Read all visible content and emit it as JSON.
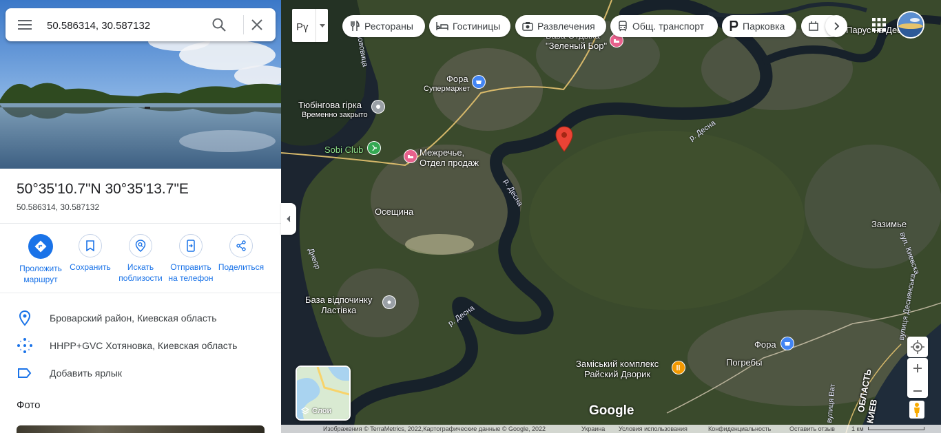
{
  "search": {
    "value": "50.586314, 30.587132"
  },
  "place": {
    "title": "50°35'10.7\"N 30°35'13.7\"E",
    "subtitle": "50.586314, 30.587132"
  },
  "actions": [
    {
      "label": "Проложить маршрут",
      "line1": "Проложить",
      "line2": "маршрут"
    },
    {
      "label": "Сохранить",
      "line1": "Сохранить",
      "line2": ""
    },
    {
      "label": "Искать поблизости",
      "line1": "Искать",
      "line2": "поблизости"
    },
    {
      "label": "Отправить на телефон",
      "line1": "Отправить",
      "line2": "на телефон"
    },
    {
      "label": "Поделиться",
      "line1": "Поделиться",
      "line2": ""
    }
  ],
  "info": {
    "address": "Броварский район, Киевская область",
    "pluscode": "HHPP+GVC Хотяновка, Киевская область",
    "label": "Добавить ярлык"
  },
  "photos_heading": "Фото",
  "map": {
    "language_button": "Рү",
    "chips": [
      "Рестораны",
      "Гостиницы",
      "Развлечения",
      "Общ. транспорт",
      "Парковка"
    ],
    "layers_label": "Слои",
    "google_logo": "Google",
    "labels": {
      "base_zeleny_bor_1": "База Отдыха",
      "base_zeleny_bor_2": "\"Зеленый Бор\"",
      "fora1": "Фора",
      "fora1_sub": "Супермаркет",
      "tubing": "Тюбінгова гірка",
      "tubing_sub": "Временно закрыто",
      "sobi": "Sobi Club",
      "mezhreche1": "Межречье,",
      "mezhreche2": "Отдел продаж",
      "osesсhina": "Осещина",
      "lastivka1": "База відпочинку",
      "lastivka2": "Ластівка",
      "zazimye": "Зазимье",
      "fora2": "Фора",
      "raysky1": "Заміський комплекс",
      "raysky2": "Райский Дворик",
      "pogreby": "Погребы",
      "parus": "Парус на Десне",
      "river_desna1": "р. Десна",
      "river_desna2": "р. Десна",
      "river_desna3": "р. Десна",
      "dnepr": "Днепр",
      "street_kyivska": "вул. Киевска",
      "street_desnyanska": "вулиця Деснянська",
      "street_vat": "вулиця Ват",
      "street_oskovitsa": "Ослововица",
      "region": "ОБЛАСТЬ",
      "kiev": "КИЕВ"
    },
    "footer": {
      "imagery": "Изображения © TerraMetrics, 2022,Картографические данные © Google, 2022",
      "country": "Украина",
      "terms": "Условия использования",
      "privacy": "Конфиденциальность",
      "feedback": "Оставить отзыв",
      "scale": "1 км"
    }
  },
  "colors": {
    "accent": "#1a73e8",
    "pin": "#ea4335"
  }
}
